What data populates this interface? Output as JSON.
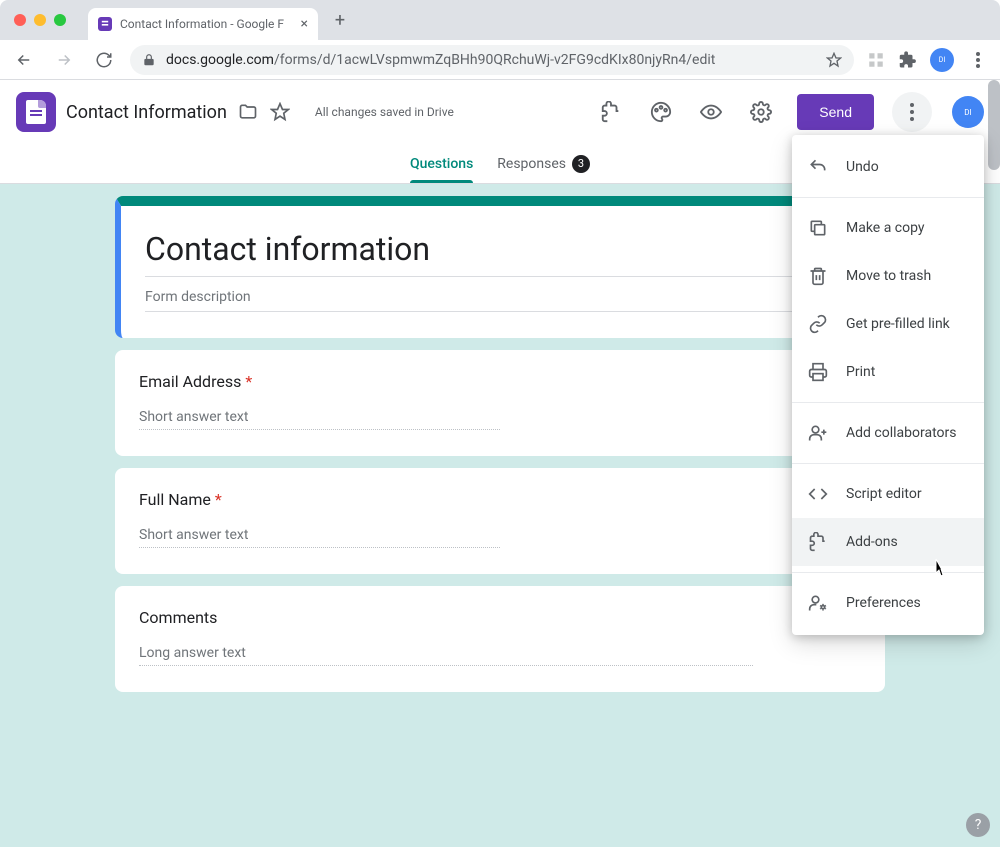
{
  "browser": {
    "tab_title": "Contact Information - Google F",
    "url_host": "docs.google.com",
    "url_path": "/forms/d/1acwLVspmwmZqBHh90QRchuWj-v2FG9cdKIx80njyRn4/edit"
  },
  "header": {
    "doc_title": "Contact Information",
    "save_status": "All changes saved in Drive",
    "send_label": "Send"
  },
  "tabs": {
    "questions": "Questions",
    "responses": "Responses",
    "responses_count": "3"
  },
  "form": {
    "title": "Contact information",
    "description_placeholder": "Form description",
    "questions": [
      {
        "label": "Email Address",
        "required": true,
        "answer_type": "Short answer text"
      },
      {
        "label": "Full Name",
        "required": true,
        "answer_type": "Short answer text"
      },
      {
        "label": "Comments",
        "required": false,
        "answer_type": "Long answer text"
      }
    ]
  },
  "menu": {
    "items": [
      {
        "icon": "undo",
        "label": "Undo"
      },
      {
        "sep": true
      },
      {
        "icon": "copy",
        "label": "Make a copy"
      },
      {
        "icon": "trash",
        "label": "Move to trash"
      },
      {
        "icon": "link",
        "label": "Get pre-filled link"
      },
      {
        "icon": "print",
        "label": "Print"
      },
      {
        "sep": true
      },
      {
        "icon": "people",
        "label": "Add collaborators"
      },
      {
        "sep": true
      },
      {
        "icon": "code",
        "label": "Script editor"
      },
      {
        "icon": "addon",
        "label": "Add-ons",
        "hovered": true
      },
      {
        "sep": true
      },
      {
        "icon": "prefs",
        "label": "Preferences"
      }
    ]
  }
}
